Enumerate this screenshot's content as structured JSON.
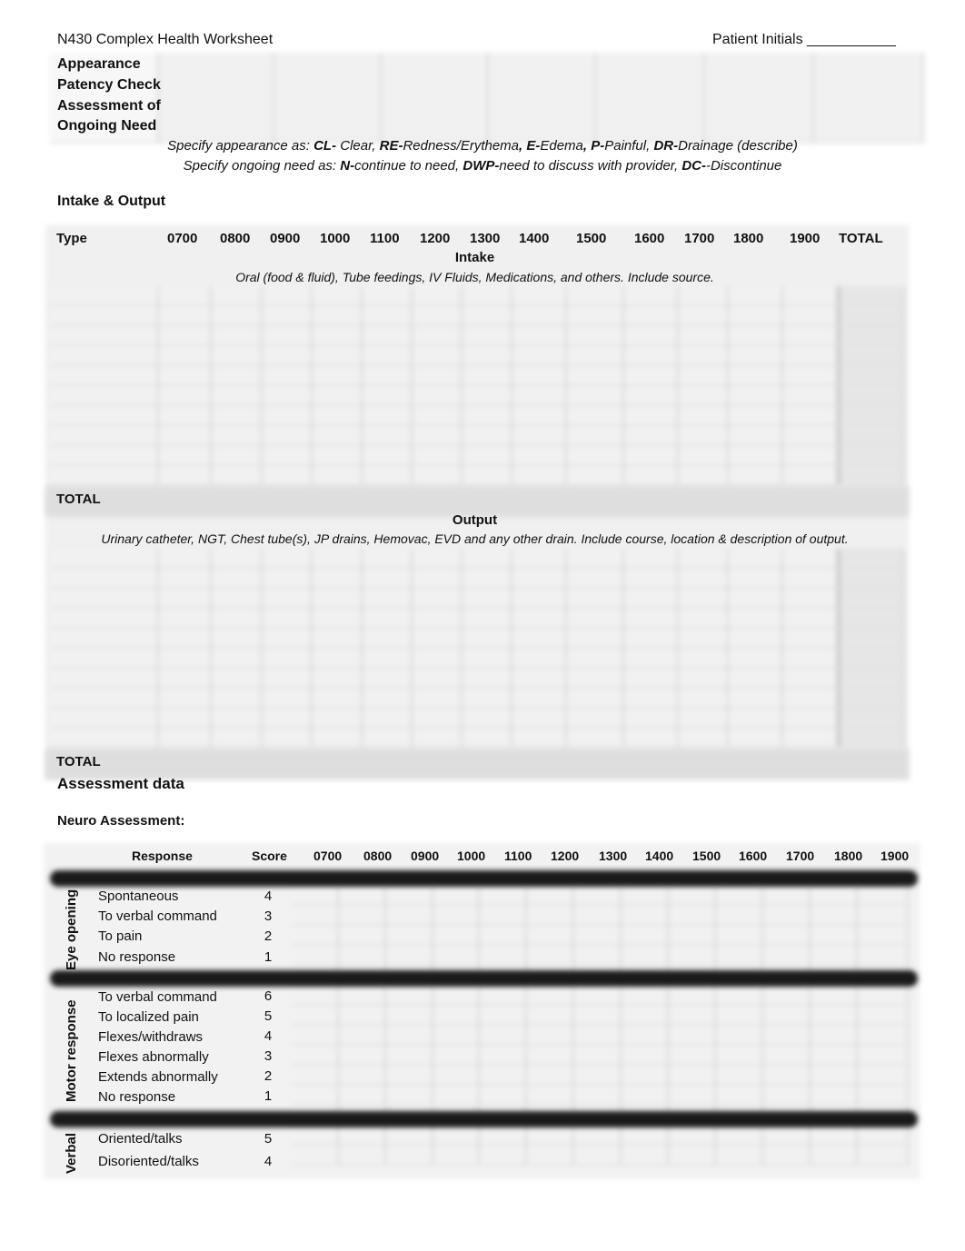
{
  "header": {
    "title": "N430 Complex Health Worksheet",
    "patient_initials_label": "Patient Initials ___________"
  },
  "line_assessment": {
    "rows": [
      "Appearance",
      "Patency Check",
      "Assessment of",
      "Ongoing Need"
    ],
    "legend_appearance": {
      "prefix": "Specify appearance as:  ",
      "items": [
        {
          "code": "CL-",
          "text": " Clear, "
        },
        {
          "code": "RE-",
          "text": "Redness/Erythema"
        },
        {
          "code": ", E-",
          "text": "Edema"
        },
        {
          "code": ", P-",
          "text": "Painful, "
        },
        {
          "code": "DR-",
          "text": "Drainage (describe)"
        }
      ]
    },
    "legend_need": {
      "prefix": "Specify ongoing need as: ",
      "items": [
        {
          "code": "N-",
          "text": "continue to need, "
        },
        {
          "code": "DWP-",
          "text": "need to discuss with provider,  "
        },
        {
          "code": "DC-",
          "text": "-Discontinue"
        }
      ]
    }
  },
  "intake_output": {
    "section_title": "Intake & Output",
    "type_label": "Type",
    "hours": [
      "0700",
      "0800",
      "0900",
      "1000",
      "1100",
      "1200",
      "1300",
      "1400",
      "1500",
      "1600",
      "1700",
      "1800",
      "1900"
    ],
    "total_label": "TOTAL",
    "intake": {
      "title": "Intake",
      "description": "Oral (food & fluid), Tube feedings, IV Fluids, Medications, and others.  Include source.",
      "total_label": "TOTAL"
    },
    "output": {
      "title": "Output",
      "description": "Urinary catheter, NGT, Chest tube(s), JP drains, Hemovac, EVD and any other drain.  Include course, location & description of output.",
      "total_label": "TOTAL"
    }
  },
  "assessment": {
    "title": "Assessment data",
    "neuro_title": "Neuro Assessment:",
    "columns": {
      "response": "Response",
      "score": "Score",
      "hours": [
        "0700",
        "0800",
        "0900",
        "1000",
        "1100",
        "1200",
        "1300",
        "1400",
        "1500",
        "1600",
        "1700",
        "1800",
        "1900"
      ]
    },
    "groups": [
      {
        "label": "Eye opening",
        "items": [
          {
            "response": "Spontaneous",
            "score": "4"
          },
          {
            "response": "To verbal command",
            "score": "3"
          },
          {
            "response": "To pain",
            "score": "2"
          },
          {
            "response": "No response",
            "score": "1"
          }
        ]
      },
      {
        "label": "Motor response",
        "items": [
          {
            "response": "To verbal command",
            "score": "6"
          },
          {
            "response": "To localized pain",
            "score": "5"
          },
          {
            "response": "Flexes/withdraws",
            "score": "4"
          },
          {
            "response": "Flexes abnormally",
            "score": "3"
          },
          {
            "response": "Extends abnormally",
            "score": "2"
          },
          {
            "response": "No response",
            "score": "1"
          }
        ]
      },
      {
        "label": "Verbal",
        "items": [
          {
            "response": "Oriented/talks",
            "score": "5"
          },
          {
            "response": "Disoriented/talks",
            "score": "4"
          }
        ]
      }
    ]
  }
}
